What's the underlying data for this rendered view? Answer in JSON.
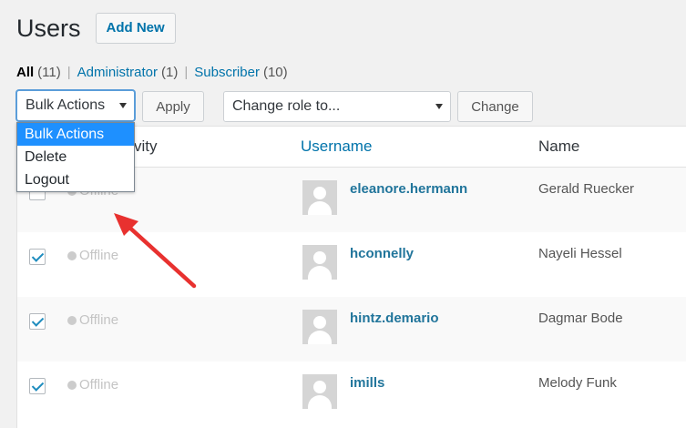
{
  "header": {
    "title": "Users",
    "add_new": "Add New"
  },
  "filters": [
    {
      "label": "All",
      "count": "(11)",
      "current": true
    },
    {
      "label": "Administrator",
      "count": "(1)",
      "current": false
    },
    {
      "label": "Subscriber",
      "count": "(10)",
      "current": false
    }
  ],
  "filter_sep": "|",
  "toolbar": {
    "bulk_selected": "Bulk Actions",
    "apply": "Apply",
    "role_placeholder": "Change role to...",
    "change": "Change"
  },
  "dropdown": {
    "options": [
      "Bulk Actions",
      "Delete",
      "Logout"
    ],
    "selected_index": 0
  },
  "table": {
    "columns": {
      "activity": "Activity",
      "activity_visible": "vity",
      "username": "Username",
      "name": "Name"
    },
    "rows": [
      {
        "checked": false,
        "status": "Offline",
        "username": "eleanore.hermann",
        "name": "Gerald Ruecker"
      },
      {
        "checked": true,
        "status": "Offline",
        "username": "hconnelly",
        "name": "Nayeli Hessel"
      },
      {
        "checked": true,
        "status": "Offline",
        "username": "hintz.demario",
        "name": "Dagmar Bode"
      },
      {
        "checked": true,
        "status": "Offline",
        "username": "imills",
        "name": "Melody Funk"
      }
    ]
  },
  "annotation": {
    "arrow_color": "#e8312f"
  },
  "colors": {
    "link": "#0073aa",
    "username": "#21759b",
    "highlight": "#1e90ff"
  }
}
